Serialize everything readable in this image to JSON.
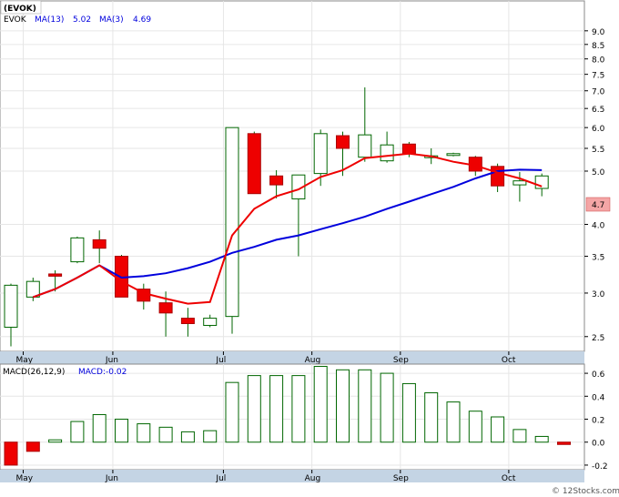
{
  "legend": {
    "ticker": "EVOK",
    "ma13_label": "MA(13)",
    "ma13_value": "5.02",
    "ma3_label": "MA(3)",
    "ma3_value": "4.69",
    "ma13_color": "#0000dd",
    "ma3_color": "#ee0000"
  },
  "badge": {
    "ticker": "(EVOK)"
  },
  "price_tag": {
    "value": "4.7"
  },
  "macd_legend": {
    "params": "MACD(26,12,9)",
    "value": "MACD:-0.02"
  },
  "credit": "© 12Stocks.com",
  "colors": {
    "up": "#ffffff",
    "up_border": "#006600",
    "down": "#ee0000",
    "ma13": "#0000dd",
    "ma3": "#ee0000",
    "macd": "#006600",
    "axisbar": "#c4d4e4"
  },
  "chart_data": [
    {
      "type": "candlestick",
      "title": "",
      "scale": "log",
      "y_ticks": [
        2.5,
        3.0,
        3.5,
        4.0,
        4.7,
        5.0,
        5.5,
        6.0,
        6.5,
        7.0,
        7.5,
        8.0,
        8.5,
        9.0
      ],
      "ylim": [
        2.35,
        10.2
      ],
      "x_month_labels": [
        "May",
        "Jun",
        "Jul",
        "Aug",
        "Sep",
        "Oct"
      ],
      "grid": true,
      "candles": [
        {
          "o": 2.6,
          "h": 3.12,
          "l": 2.4,
          "c": 3.1
        },
        {
          "o": 2.95,
          "h": 3.2,
          "l": 2.9,
          "c": 3.15
        },
        {
          "o": 3.25,
          "h": 3.3,
          "l": 3.02,
          "c": 3.22
        },
        {
          "o": 3.42,
          "h": 3.8,
          "l": 3.4,
          "c": 3.78
        },
        {
          "o": 3.75,
          "h": 3.9,
          "l": 3.4,
          "c": 3.62
        },
        {
          "o": 3.5,
          "h": 3.52,
          "l": 2.95,
          "c": 2.95
        },
        {
          "o": 3.05,
          "h": 3.12,
          "l": 2.8,
          "c": 2.9
        },
        {
          "o": 2.88,
          "h": 3.02,
          "l": 2.5,
          "c": 2.76
        },
        {
          "o": 2.7,
          "h": 2.82,
          "l": 2.5,
          "c": 2.64
        },
        {
          "o": 2.62,
          "h": 2.74,
          "l": 2.6,
          "c": 2.7
        },
        {
          "o": 2.72,
          "h": 6.0,
          "l": 2.53,
          "c": 6.0
        },
        {
          "o": 5.85,
          "h": 5.9,
          "l": 4.55,
          "c": 4.55
        },
        {
          "o": 4.9,
          "h": 5.02,
          "l": 4.46,
          "c": 4.72
        },
        {
          "o": 4.45,
          "h": 4.82,
          "l": 3.5,
          "c": 4.92
        },
        {
          "o": 4.95,
          "h": 5.95,
          "l": 4.7,
          "c": 5.85
        },
        {
          "o": 5.8,
          "h": 5.9,
          "l": 4.9,
          "c": 5.5
        },
        {
          "o": 5.3,
          "h": 7.1,
          "l": 5.2,
          "c": 5.82
        },
        {
          "o": 5.22,
          "h": 5.9,
          "l": 5.18,
          "c": 5.58
        },
        {
          "o": 5.6,
          "h": 5.65,
          "l": 5.3,
          "c": 5.38
        },
        {
          "o": 5.3,
          "h": 5.5,
          "l": 5.15,
          "c": 5.33
        },
        {
          "o": 5.37,
          "h": 5.4,
          "l": 5.32,
          "c": 5.38
        },
        {
          "o": 5.3,
          "h": 5.33,
          "l": 4.9,
          "c": 5.0
        },
        {
          "o": 5.1,
          "h": 5.16,
          "l": 4.58,
          "c": 4.7
        },
        {
          "o": 4.72,
          "h": 4.98,
          "l": 4.4,
          "c": 4.8
        },
        {
          "o": 4.65,
          "h": 4.95,
          "l": 4.5,
          "c": 4.9
        }
      ],
      "ma13": [
        null,
        2.95,
        3.05,
        3.2,
        3.37,
        3.15,
        3.0,
        2.93,
        2.87,
        2.89,
        3.82,
        4.27,
        4.5,
        4.63,
        4.88,
        5.02,
        5.28,
        5.33,
        5.38,
        5.32,
        5.2,
        5.12,
        4.97,
        4.85,
        4.69
      ],
      "ma3": [
        null,
        2.95,
        3.05,
        3.2,
        3.37,
        3.2,
        3.22,
        3.26,
        3.33,
        3.42,
        3.55,
        3.64,
        3.75,
        3.82,
        3.92,
        4.02,
        4.13,
        4.27,
        4.4,
        4.54,
        4.68,
        4.85,
        5.0,
        5.03,
        5.02
      ]
    },
    {
      "type": "bar",
      "title": "",
      "y_ticks": [
        -0.2,
        0.0,
        0.2,
        0.4,
        0.6
      ],
      "ylim": [
        -0.24,
        0.68
      ],
      "x_month_labels": [
        "May",
        "Jun",
        "Jul",
        "Aug",
        "Sep",
        "Oct"
      ],
      "values": [
        -0.2,
        -0.08,
        0.02,
        0.18,
        0.24,
        0.2,
        0.16,
        0.13,
        0.09,
        0.1,
        0.52,
        0.58,
        0.58,
        0.58,
        0.66,
        0.63,
        0.63,
        0.6,
        0.51,
        0.43,
        0.35,
        0.27,
        0.22,
        0.11,
        0.05,
        -0.02
      ]
    }
  ]
}
